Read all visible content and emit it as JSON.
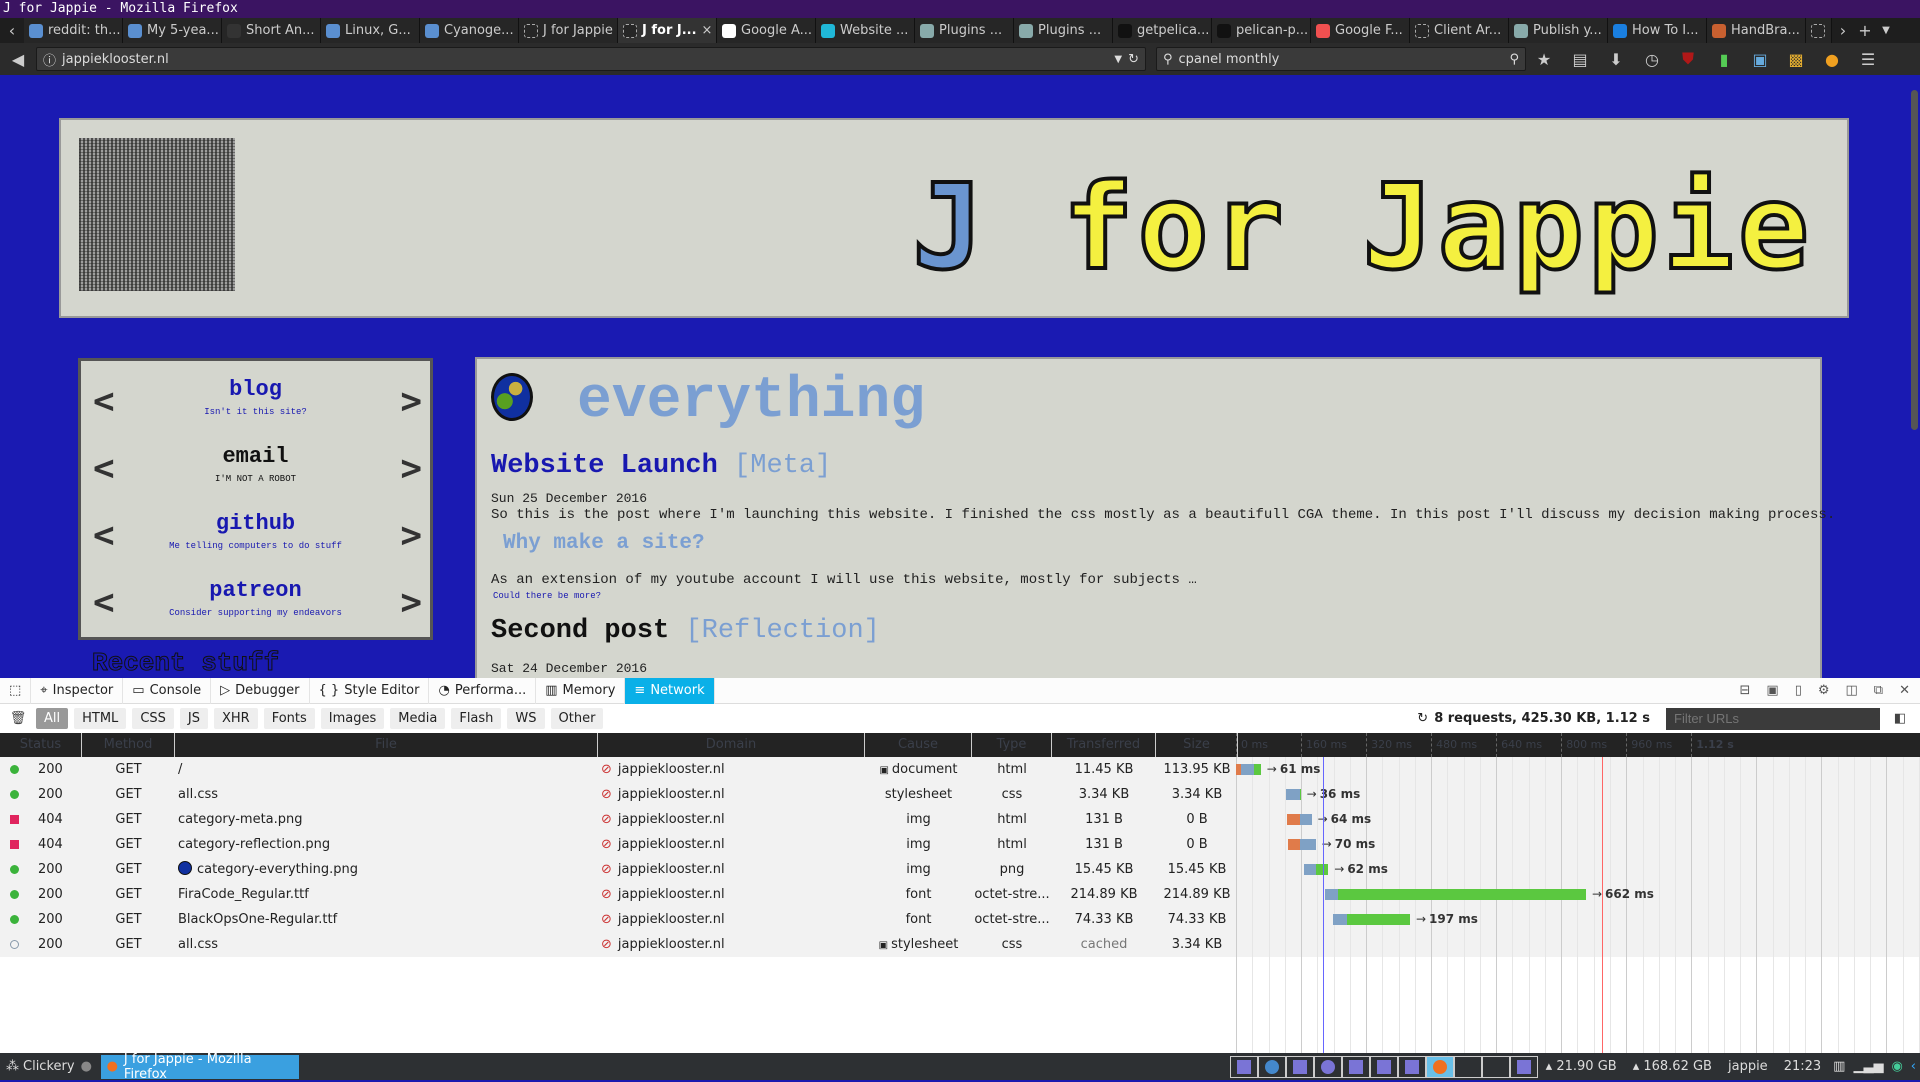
{
  "window": {
    "title": "J for Jappie - Mozilla Firefox"
  },
  "tabs": [
    {
      "label": "reddit: th...",
      "icon": "reddit-icon",
      "color": "#5a8fd0"
    },
    {
      "label": "My 5-yea...",
      "icon": "reddit-icon",
      "color": "#5a8fd0"
    },
    {
      "label": "Short An...",
      "icon": "music-icon",
      "color": "#333333"
    },
    {
      "label": "Linux, G...",
      "icon": "reddit-icon",
      "color": "#5a8fd0"
    },
    {
      "label": "Cyanoge...",
      "icon": "reddit-icon",
      "color": "#5a8fd0"
    },
    {
      "label": "J for Jappie",
      "icon": "blank-page-icon",
      "color": "#262626"
    },
    {
      "label": "J for J...",
      "icon": "blank-page-icon",
      "color": "#262626",
      "active": true
    },
    {
      "label": "Google A...",
      "icon": "google-icon",
      "color": "#ffffff"
    },
    {
      "label": "Website ...",
      "icon": "website-icon",
      "color": "#20b8d8"
    },
    {
      "label": "Plugins ...",
      "icon": "book-icon",
      "color": "#8aa"
    },
    {
      "label": "Plugins ...",
      "icon": "book-icon",
      "color": "#8aa"
    },
    {
      "label": "getpelica...",
      "icon": "github-icon",
      "color": "#111111"
    },
    {
      "label": "pelican-p...",
      "icon": "github-icon",
      "color": "#111111"
    },
    {
      "label": "Google F...",
      "icon": "google-fonts-icon",
      "color": "#f05050"
    },
    {
      "label": "Client Ar...",
      "icon": "blank-page-icon",
      "color": "#262626"
    },
    {
      "label": "Publish y...",
      "icon": "book-icon",
      "color": "#8aa"
    },
    {
      "label": "How To I...",
      "icon": "digitalocean-icon",
      "color": "#1a7fe0"
    },
    {
      "label": "HandBra...",
      "icon": "handbrake-icon",
      "color": "#c86030"
    }
  ],
  "navbar": {
    "url": "jappieklooster.nl",
    "search": "cpanel monthly"
  },
  "site": {
    "title_j": "J",
    "title_rest": " for Jappie",
    "sidebar": [
      {
        "label": "blog",
        "sub": "Isn't it this site?"
      },
      {
        "label": "email",
        "sub": "I'M NOT A ROBOT"
      },
      {
        "label": "github",
        "sub": "Me telling computers to do stuff"
      },
      {
        "label": "patreon",
        "sub": "Consider supporting my endeavors"
      }
    ],
    "recent": "Recent stuff",
    "category": "everything",
    "posts": [
      {
        "title": "Website Launch",
        "tag": "[Meta]",
        "date": "Sun 25 December 2016",
        "body": "So this is the post where I'm launching this website. I finished the css mostly as a beautifull CGA theme. In this post I'll discuss my decision making process.",
        "subheading": "Why make a site?",
        "para": "As an extension of my youtube account I will use this website, mostly for subjects …",
        "more": "Could there be more?"
      },
      {
        "title": "Second post",
        "tag": "[Reflection]",
        "date": "Sat 24 December 2016"
      }
    ]
  },
  "devtools": {
    "tabs": [
      "Inspector",
      "Console",
      "Debugger",
      "Style Editor",
      "Performa...",
      "Memory",
      "Network"
    ],
    "active_tab": "Network",
    "filters": [
      "All",
      "HTML",
      "CSS",
      "JS",
      "XHR",
      "Fonts",
      "Images",
      "Media",
      "Flash",
      "WS",
      "Other"
    ],
    "summary": "8 requests, 425.30 KB, 1.12 s",
    "filter_placeholder": "Filter URLs",
    "columns": [
      "Status",
      "Method",
      "File",
      "Domain",
      "Cause",
      "Type",
      "Transferred",
      "Size"
    ],
    "timeline_ticks": [
      "0 ms",
      "160 ms",
      "320 ms",
      "480 ms",
      "640 ms",
      "800 ms",
      "960 ms",
      "1.12 s"
    ],
    "dom_content_loaded_ms": 214,
    "load_ms": 900,
    "requests": [
      {
        "status": "200",
        "method": "GET",
        "file": "/",
        "domain": "jappieklooster.nl",
        "cause": "document",
        "type": "html",
        "transferred": "11.45 KB",
        "size": "113.95 KB",
        "start": 0,
        "phases": [
          12,
          32,
          17
        ],
        "time": "61 ms",
        "state": "ok"
      },
      {
        "status": "200",
        "method": "GET",
        "file": "all.css",
        "domain": "jappieklooster.nl",
        "cause": "stylesheet",
        "type": "css",
        "transferred": "3.34 KB",
        "size": "3.34 KB",
        "start": 123,
        "phases": [
          0,
          34,
          2
        ],
        "time": "36 ms",
        "state": "ok"
      },
      {
        "status": "404",
        "method": "GET",
        "file": "category-meta.png",
        "domain": "jappieklooster.nl",
        "cause": "img",
        "type": "html",
        "transferred": "131 B",
        "size": "0 B",
        "start": 126,
        "phases": [
          31,
          29,
          0
        ],
        "time": "64 ms",
        "state": "error"
      },
      {
        "status": "404",
        "method": "GET",
        "file": "category-reflection.png",
        "domain": "jappieklooster.nl",
        "cause": "img",
        "type": "html",
        "transferred": "131 B",
        "size": "0 B",
        "start": 128,
        "phases": [
          30,
          38,
          0
        ],
        "time": "70 ms",
        "state": "error"
      },
      {
        "status": "200",
        "method": "GET",
        "file": "category-everything.png",
        "domain": "jappieklooster.nl",
        "cause": "img",
        "type": "png",
        "transferred": "15.45 KB",
        "size": "15.45 KB",
        "start": 167,
        "phases": [
          0,
          30,
          30
        ],
        "time": "62 ms",
        "state": "ok",
        "thumb": true
      },
      {
        "status": "200",
        "method": "GET",
        "file": "FiraCode_Regular.ttf",
        "domain": "jappieklooster.nl",
        "cause": "font",
        "type": "octet-stre...",
        "transferred": "214.89 KB",
        "size": "214.89 KB",
        "start": 219,
        "phases": [
          0,
          33,
          609
        ],
        "time": "662 ms",
        "state": "ok"
      },
      {
        "status": "200",
        "method": "GET",
        "file": "BlackOpsOne-Regular.ttf",
        "domain": "jappieklooster.nl",
        "cause": "font",
        "type": "octet-stre...",
        "transferred": "74.33 KB",
        "size": "74.33 KB",
        "start": 239,
        "phases": [
          0,
          33,
          156
        ],
        "time": "197 ms",
        "state": "ok"
      },
      {
        "status": "200",
        "method": "GET",
        "file": "all.css",
        "domain": "jappieklooster.nl",
        "cause": "stylesheet",
        "type": "css",
        "transferred": "cached",
        "size": "3.34 KB",
        "state": "cached"
      }
    ]
  },
  "taskbar": {
    "menu": "Clickery",
    "window": "J for Jappie - Mozilla Firefox",
    "disk1": "21.90 GB",
    "disk2": "168.62 GB",
    "user": "jappie",
    "clock": "21:23"
  },
  "colors": {
    "page_bg": "#1a1ab2",
    "panel": "#d4d6ce",
    "accent_blue": "#1818b0",
    "light_blue": "#7b9fd2",
    "title_yellow": "#f4f040",
    "network_active": "#0ab0e8",
    "phase_blocked": "#e07b4a",
    "phase_wait": "#7fa1c5",
    "phase_receive": "#5bc840"
  }
}
